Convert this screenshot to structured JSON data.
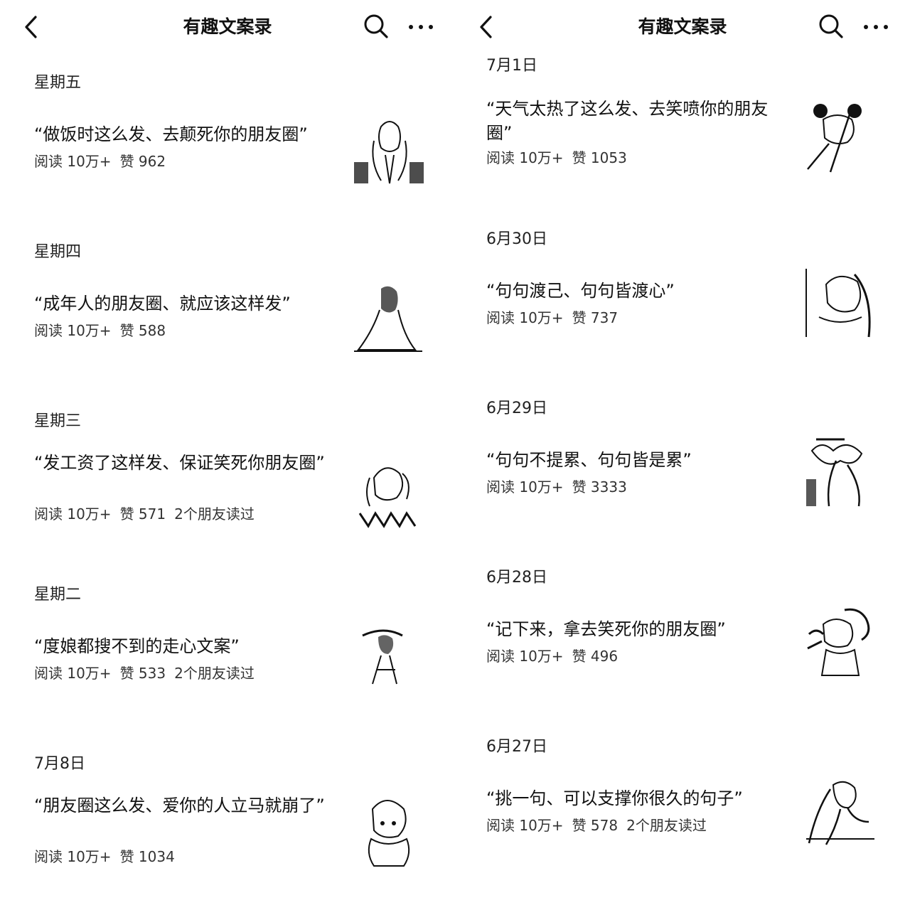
{
  "left": {
    "nav": {
      "title": "有趣文案录"
    },
    "days": [
      {
        "label": "星期五",
        "article": {
          "title": "“做饭时这么发、去颠死你的朋友圈”",
          "reads": "阅读 10万+",
          "likes": "赞 962",
          "friends": ""
        }
      },
      {
        "label": "星期四",
        "article": {
          "title": "“成年人的朋友圈、就应该这样发”",
          "reads": "阅读 10万+",
          "likes": "赞 588",
          "friends": ""
        }
      },
      {
        "label": "星期三",
        "article": {
          "title": "“发工资了这样发、保证笑死你朋友圈”",
          "reads": "阅读 10万+",
          "likes": "赞 571",
          "friends": "2个朋友读过"
        }
      },
      {
        "label": "星期二",
        "article": {
          "title": "“度娘都搜不到的走心文案”",
          "reads": "阅读 10万+",
          "likes": "赞 533",
          "friends": "2个朋友读过"
        }
      },
      {
        "label": "7月8日",
        "article": {
          "title": "“朋友圈这么发、爱你的人立马就崩了”",
          "reads": "阅读 10万+",
          "likes": "赞 1034",
          "friends": ""
        }
      }
    ]
  },
  "right": {
    "nav": {
      "title": "有趣文案录"
    },
    "days": [
      {
        "label": "7月1日",
        "article": {
          "title": "“天气太热了这么发、去笑喷你的朋友圈”",
          "reads": "阅读 10万+",
          "likes": "赞 1053",
          "friends": ""
        }
      },
      {
        "label": "6月30日",
        "article": {
          "title": "“句句渡己、句句皆渡心”",
          "reads": "阅读 10万+",
          "likes": "赞 737",
          "friends": ""
        }
      },
      {
        "label": "6月29日",
        "article": {
          "title": "“句句不提累、句句皆是累”",
          "reads": "阅读 10万+",
          "likes": "赞 3333",
          "friends": ""
        }
      },
      {
        "label": "6月28日",
        "article": {
          "title": "“记下来，拿去笑死你的朋友圈”",
          "reads": "阅读 10万+",
          "likes": "赞 496",
          "friends": ""
        }
      },
      {
        "label": "6月27日",
        "article": {
          "title": "“挑一句、可以支撑你很久的句子”",
          "reads": "阅读 10万+",
          "likes": "赞 578",
          "friends": "2个朋友读过"
        }
      }
    ]
  },
  "icons": {
    "back": "chevron-left-icon",
    "search": "search-icon",
    "more": "more-dots-icon",
    "thumbnail": "girl-illustration-thumbnail"
  }
}
